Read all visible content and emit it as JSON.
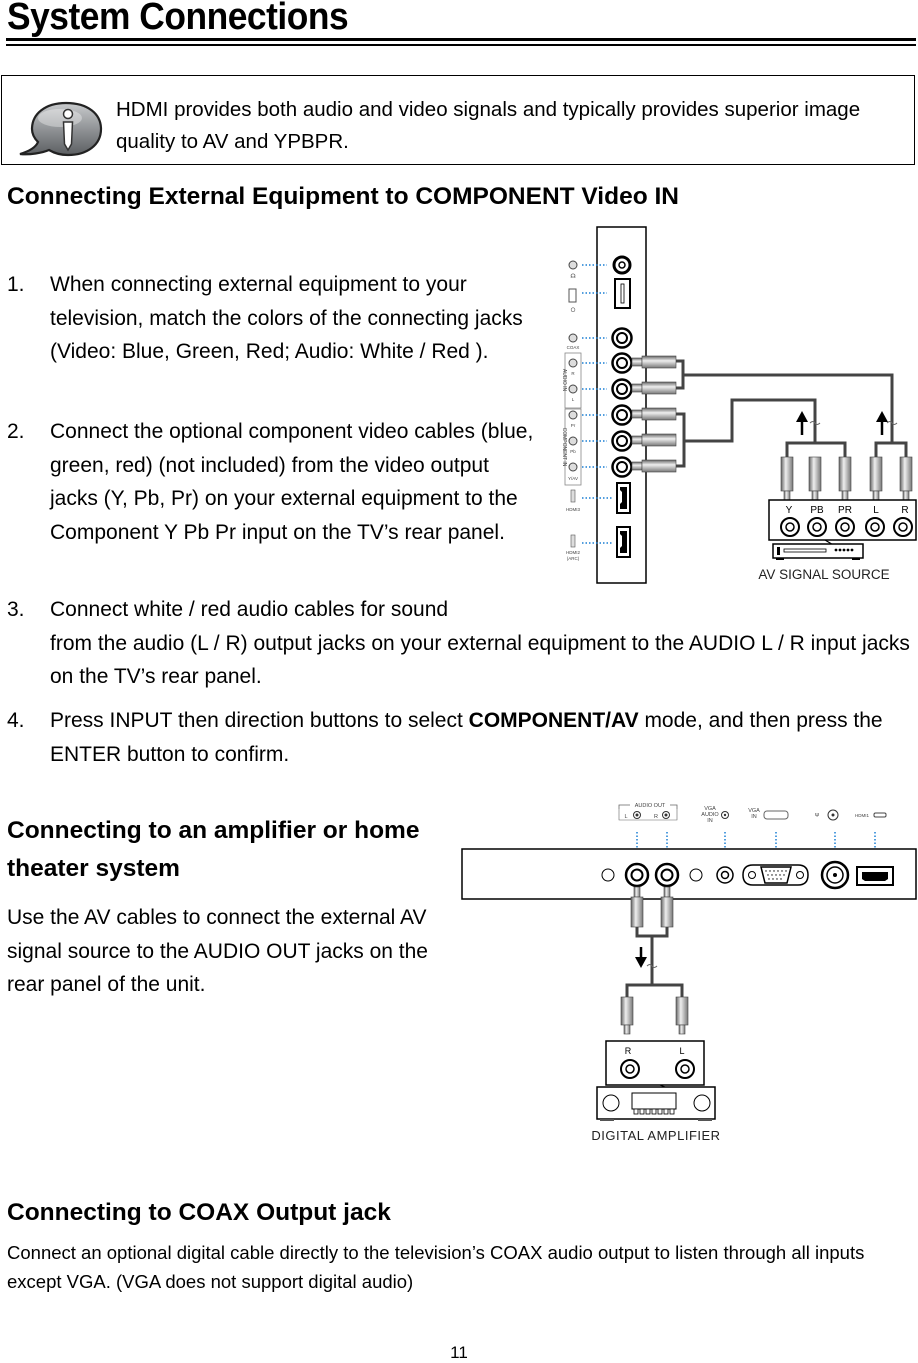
{
  "page": {
    "title": "System Connections",
    "page_number": "11"
  },
  "note": {
    "icon": "info-speech-bubble-icon",
    "text": "HDMI provides both audio and video signals and typically provides superior image quality to AV and YPBPR."
  },
  "component_section": {
    "heading": "Connecting External Equipment to COMPONENT Video IN",
    "steps": [
      {
        "num": "1.",
        "text": "When connecting external equipment to your television, match the colors of the connecting jacks (Video: Blue, Green, Red; Audio: White / Red )."
      },
      {
        "num": "2.",
        "text": "Connect the optional component video cables (blue, green, red) (not included) from the video output jacks (Y, Pb, Pr) on your external equipment to the Component Y Pb Pr input on the TV’s rear panel."
      },
      {
        "num": "3.",
        "text_line1": "Connect white / red audio cables for sound",
        "text_rest": "from the audio (L / R) output jacks on your external equipment to the AUDIO L / R input jacks on the TV’s rear panel."
      },
      {
        "num": "4.",
        "text_before": "Press INPUT then direction buttons to select ",
        "text_bold": "COMPONENT/AV",
        "text_after": " mode, and then press the ENTER button to confirm."
      }
    ],
    "diagram": {
      "tv_labels": {
        "headphone": "☊",
        "coax": "COAX",
        "audio_in": "AUDIO IN",
        "audio_r": "R",
        "audio_l": "L",
        "component_in": "COMPONENT IN",
        "pr": "Pr",
        "pb": "Pb",
        "y": "Y/AV",
        "hdmi3": "HDMI3",
        "hdmi2": "HDMI2",
        "hdmi2_sub": "(ARC)"
      },
      "source_jacks": [
        "Y",
        "PB",
        "PR",
        "L",
        "R"
      ],
      "source_label": "AV SIGNAL SOURCE"
    }
  },
  "amplifier_section": {
    "heading": "Connecting to an amplifier or home theater system",
    "body": "Use the AV cables to connect the external AV signal source to the AUDIO OUT jacks on the rear panel of the unit.",
    "diagram": {
      "audio_out_label": "AUDIO OUT",
      "audio_out_l": "L",
      "audio_out_r": "R",
      "vga_audio_in": [
        "VGA",
        "AUDIO",
        "IN"
      ],
      "vga_in": [
        "VGA",
        "IN"
      ],
      "antenna_label": "Ψ",
      "hdmi1_label": "HDMI1",
      "amp_jacks": [
        "R",
        "L"
      ],
      "amp_label": "DIGITAL AMPLIFIER"
    }
  },
  "coax_section": {
    "heading": "Connecting to COAX Output jack",
    "body": "Connect an optional digital cable directly to the television’s COAX audio output to listen through all inputs except VGA. (VGA does not support digital audio)"
  }
}
